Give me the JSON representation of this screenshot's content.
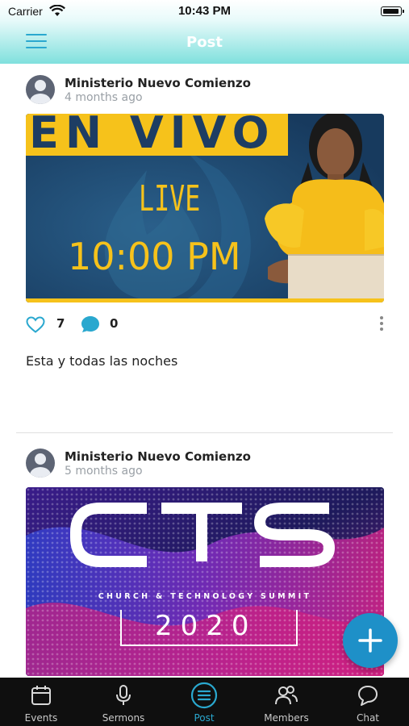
{
  "status_bar": {
    "carrier": "Carrier",
    "time": "10:43 PM"
  },
  "header": {
    "title": "Post"
  },
  "posts": [
    {
      "author": "Ministerio Nuevo Comienzo",
      "time_ago": "4 months ago",
      "image_text": {
        "headline": "EN VIVO",
        "live": "LIVE",
        "time": "10:00 PM"
      },
      "likes": "7",
      "comments": "0",
      "caption": "Esta y todas las noches"
    },
    {
      "author": "Ministerio Nuevo Comienzo",
      "time_ago": "5 months ago",
      "image_text": {
        "logo": "CTS",
        "subtitle": "CHURCH & TECHNOLOGY SUMMIT",
        "year": "2020"
      }
    }
  ],
  "tabs": [
    {
      "label": "Events",
      "icon": "calendar-icon"
    },
    {
      "label": "Sermons",
      "icon": "microphone-icon"
    },
    {
      "label": "Post",
      "icon": "post-list-icon",
      "active": true
    },
    {
      "label": "Members",
      "icon": "members-icon"
    },
    {
      "label": "Chat",
      "icon": "chat-bubble-icon"
    }
  ],
  "colors": {
    "accent": "#2aa8cf",
    "fab": "#1e90c8",
    "header_gradient_end": "#7fe0dd",
    "tabbar": "#0f0f0f",
    "live_yellow": "#f6c21b",
    "live_navy": "#1d3d63"
  }
}
